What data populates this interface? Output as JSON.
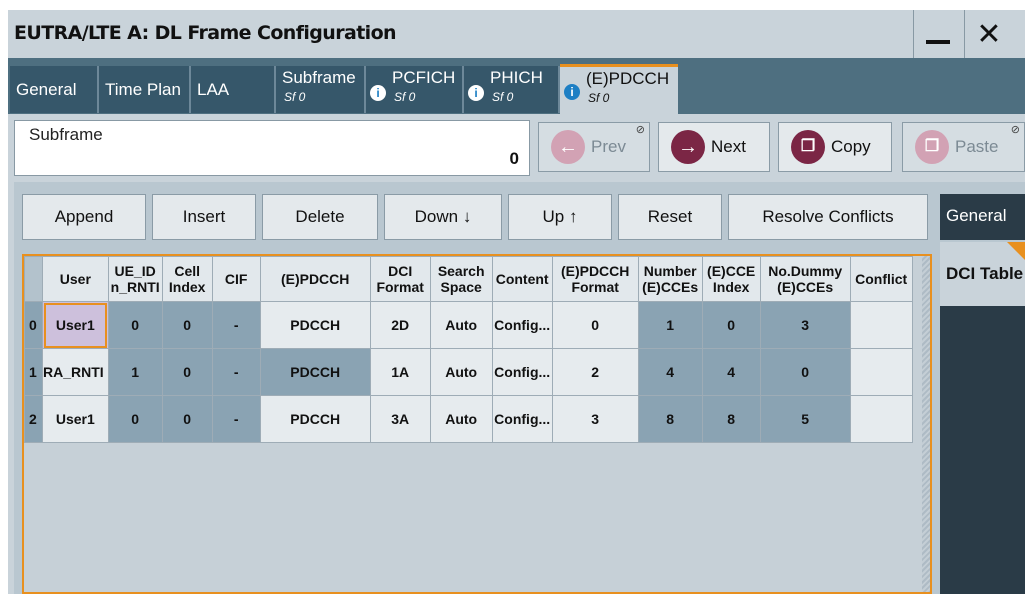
{
  "window": {
    "title": "EUTRA/LTE A: DL Frame Configuration",
    "minimize_icon": "minimize-icon",
    "close_label": "✕"
  },
  "tabs": [
    {
      "label": "General"
    },
    {
      "label": "Time Plan"
    },
    {
      "label": "LAA"
    },
    {
      "label": "Subframe",
      "sub": "Sf 0"
    },
    {
      "label": "PCFICH",
      "sub": "Sf 0",
      "icon": "info-icon"
    },
    {
      "label": "PHICH",
      "sub": "Sf 0",
      "icon": "info-icon"
    },
    {
      "label": "(E)PDCCH",
      "sub": "Sf 0",
      "icon": "info-icon"
    }
  ],
  "subframe": {
    "label": "Subframe",
    "value": "0"
  },
  "nav": {
    "prev": "Prev",
    "next": "Next",
    "copy": "Copy",
    "paste": "Paste"
  },
  "toolbar": {
    "append": "Append",
    "insert": "Insert",
    "delete": "Delete",
    "down": "Down ↓",
    "up": "Up ↑",
    "reset": "Reset",
    "resolve": "Resolve Conflicts"
  },
  "side_tabs": {
    "general": "General",
    "dci": "DCI Table"
  },
  "table": {
    "headers": [
      "User",
      "UE_ID n_RNTI",
      "Cell Index",
      "CIF",
      "(E)PDCCH",
      "DCI Format",
      "Search Space",
      "Content",
      "(E)PDCCH Format",
      "Number (E)CCEs",
      "(E)CCE Index",
      "No.Dummy (E)CCEs",
      "Conflict"
    ],
    "rows": [
      {
        "idx": "0",
        "cells": [
          "User1",
          "0",
          "0",
          "-",
          "PDCCH",
          "2D",
          "Auto",
          "Config...",
          "0",
          "1",
          "0",
          "3",
          ""
        ]
      },
      {
        "idx": "1",
        "cells": [
          "RA_RNTI",
          "1",
          "0",
          "-",
          "PDCCH",
          "1A",
          "Auto",
          "Config...",
          "2",
          "4",
          "4",
          "0",
          ""
        ]
      },
      {
        "idx": "2",
        "cells": [
          "User1",
          "0",
          "0",
          "-",
          "PDCCH",
          "3A",
          "Auto",
          "Config...",
          "3",
          "8",
          "8",
          "5",
          ""
        ]
      }
    ]
  },
  "colors": {
    "accent": "#e8901f",
    "brand": "#7b2645",
    "tab_bg": "#36576a"
  }
}
